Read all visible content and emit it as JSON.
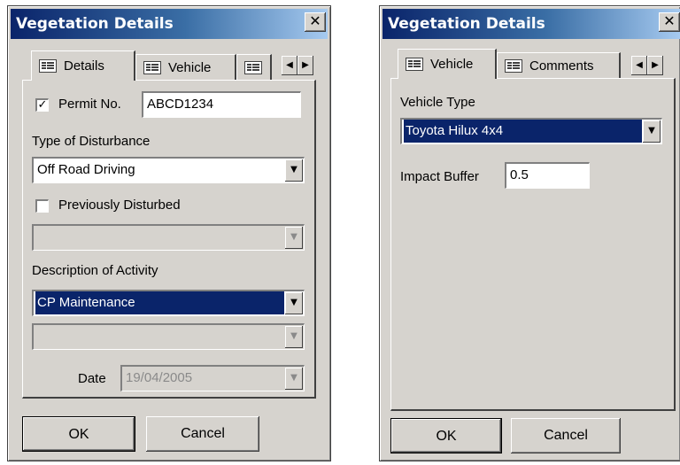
{
  "left_dialog": {
    "title": "Vegetation Details",
    "close_glyph": "✕",
    "tabs": [
      {
        "label": "Details",
        "icon": "form-icon"
      },
      {
        "label": "Vehicle",
        "icon": "form-icon"
      },
      {
        "label": "",
        "icon": "form-icon"
      }
    ],
    "scroll_left": "◀",
    "scroll_right": "▶",
    "permit": {
      "checked": true,
      "check_glyph": "✓",
      "label": "Permit No.",
      "value": "ABCD1234"
    },
    "disturbance": {
      "label": "Type of Disturbance",
      "value": "Off Road Driving"
    },
    "previously_disturbed": {
      "checked": false,
      "label": "Previously Disturbed",
      "value": ""
    },
    "activity": {
      "label": "Description of Activity",
      "value": "CP Maintenance",
      "sub_value": ""
    },
    "date": {
      "label": "Date",
      "value": "19/04/2005"
    },
    "ok_label": "OK",
    "cancel_label": "Cancel"
  },
  "right_dialog": {
    "title": "Vegetation Details",
    "close_glyph": "✕",
    "tabs": [
      {
        "label": "Vehicle",
        "icon": "form-icon"
      },
      {
        "label": "Comments",
        "icon": "form-icon"
      }
    ],
    "scroll_left": "◀",
    "scroll_right": "▶",
    "vehicle_type": {
      "label": "Vehicle Type",
      "value": "Toyota Hilux 4x4"
    },
    "impact_buffer": {
      "label": "Impact Buffer",
      "value": "0.5"
    },
    "ok_label": "OK",
    "cancel_label": "Cancel"
  },
  "dropdown_glyph": "▼"
}
